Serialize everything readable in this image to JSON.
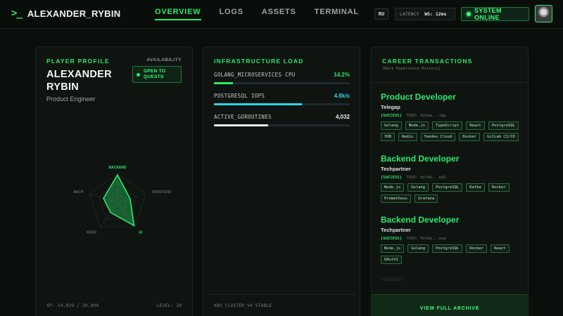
{
  "header": {
    "logo_mark": ">_",
    "logo_text": "ALEXANDER_RYBIN",
    "nav": [
      {
        "label": "OVERVIEW",
        "active": true
      },
      {
        "label": "LOGS",
        "active": false
      },
      {
        "label": "ASSETS",
        "active": false
      },
      {
        "label": "TERMINAL",
        "active": false
      }
    ],
    "language": "RU",
    "latency_label": "LATENCY",
    "latency_value": "WS: 12ms",
    "status": "SYSTEM ONLINE",
    "avatar_icon": "user-avatar"
  },
  "profile": {
    "title": "PLAYER PROFILE",
    "availability_label": "AVAILABILITY",
    "availability_status": "OPEN TO QUESTS",
    "name": "ALEXANDER RYBIN",
    "role": "Product Engineer",
    "radar": {
      "axes": [
        "BACKEND",
        "FRONTEND",
        "AI",
        "WEB3",
        "ARCH"
      ],
      "values": [
        0.95,
        0.45,
        0.95,
        0.4,
        0.5
      ],
      "highlighted": [
        "BACKEND",
        "AI"
      ]
    },
    "xp": "XP: 14,029 / 20,000",
    "level": "LEVEL: 28"
  },
  "infra": {
    "title": "INFRASTRUCTURE LOAD",
    "metrics": [
      {
        "label": "GOLANG_MICROSERVICES CPU",
        "value": "14.2%",
        "fill": 0.142,
        "color": "#2ee86b"
      },
      {
        "label": "POSTGRESQL IOPS",
        "value": "4.8k/s",
        "fill": 0.65,
        "color": "#2ed3e8"
      },
      {
        "label": "ACTIVE_GOROUTINES",
        "value": "4,032",
        "fill": 0.4,
        "color": "#e8efe9"
      }
    ],
    "footer": "K8S_CLUSTER_V4_STABLE"
  },
  "career": {
    "title": "CAREER TRANSACTIONS",
    "subtitle": "[Work Experience History]",
    "jobs": [
      {
        "title": "Product Developer",
        "company": "Telegap",
        "status": "[SUCCESS]",
        "txid": "TXID: 0x91a...tgp",
        "tags": [
          "Golang",
          "Node.js",
          "TypeScript",
          "React",
          "PostgreSQL",
          "YDB",
          "Redis",
          "Yandex Cloud",
          "Docker",
          "GitLab CI/CD"
        ]
      },
      {
        "title": "Backend Developer",
        "company": "Techpartner",
        "status": "[SUCCESS]",
        "txid": "TXID: 0x7eb...kd1",
        "tags": [
          "Node.js",
          "Golang",
          "PostgreSQL",
          "Kafka",
          "Docker",
          "Prometheus",
          "Grafana"
        ]
      },
      {
        "title": "Backend Developer",
        "company": "Techpartner",
        "status": "[SUCCESS]",
        "txid": "TXID: 0x7eb...ecp",
        "tags": [
          "Node.js",
          "Golang",
          "PostgreSQL",
          "Docker",
          "React",
          "OAuth2"
        ]
      }
    ],
    "queued": "[QUEUED]",
    "archive_button": "VIEW FULL ARCHIVE"
  }
}
